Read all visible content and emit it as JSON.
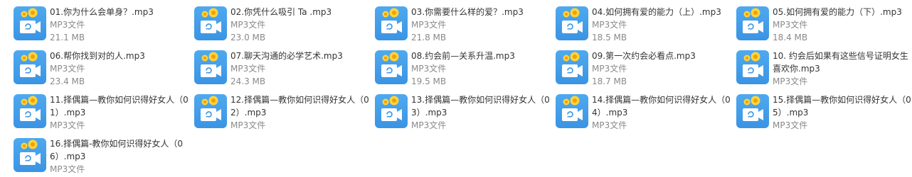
{
  "files": [
    {
      "name": "01.你为什么会单身？.mp3",
      "type": "MP3文件",
      "size": "21.1 MB"
    },
    {
      "name": "02.你凭什么吸引 Ta .mp3",
      "type": "MP3文件",
      "size": "23.0 MB"
    },
    {
      "name": "03.你需要什么样的爱？.mp3",
      "type": "MP3文件",
      "size": "21.8 MB"
    },
    {
      "name": "04.如何拥有爱的能力（上）.mp3",
      "type": "MP3文件",
      "size": "18.5 MB"
    },
    {
      "name": "05.如何拥有爱的能力（下）.mp3",
      "type": "MP3文件",
      "size": "18.4 MB"
    },
    {
      "name": "06.帮你找到对的人.mp3",
      "type": "MP3文件",
      "size": "23.4 MB"
    },
    {
      "name": "07.聊天沟通的必学艺术.mp3",
      "type": "MP3文件",
      "size": "24.3 MB"
    },
    {
      "name": "08.约会前—关系升温.mp3",
      "type": "MP3文件",
      "size": "19.5 MB"
    },
    {
      "name": "09.第一次约会必看点.mp3",
      "type": "MP3文件",
      "size": "18.7 MB"
    },
    {
      "name": "10. 约会后如果有这些信号证明女生喜欢你.mp3",
      "type": "MP3文件",
      "size": ""
    },
    {
      "name": "11.择偶篇—教你如何识得好女人（01）.mp3",
      "type": "MP3文件",
      "size": ""
    },
    {
      "name": "12.择偶篇—教你如何识得好女人（02）.mp3",
      "type": "MP3文件",
      "size": ""
    },
    {
      "name": "13.择偶篇—教你如何识得好女人（03）.mp3",
      "type": "MP3文件",
      "size": ""
    },
    {
      "name": "14.择偶篇—教你如何识得好女人（04）.mp3",
      "type": "MP3文件",
      "size": ""
    },
    {
      "name": "15.择偶篇—教你如何识得好女人（05）.mp3",
      "type": "MP3文件",
      "size": ""
    },
    {
      "name": "16.择偶篇-教你如何识得好女人（06）.mp3",
      "type": "MP3文件",
      "size": ""
    }
  ],
  "icon": "audio-file-icon"
}
